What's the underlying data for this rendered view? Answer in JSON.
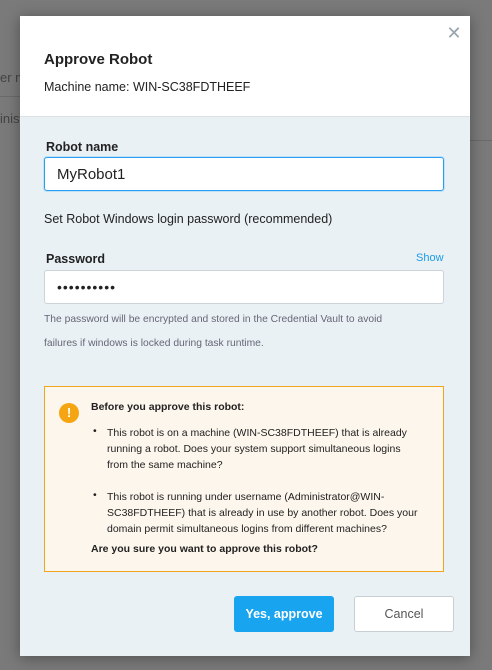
{
  "background": {
    "fragment_1": "er m",
    "fragment_2": "inistr"
  },
  "dialog": {
    "title": "Approve Robot",
    "machine_label": "Machine name:",
    "machine_name": "WIN-SC38FDTHEEF",
    "close_icon": "close-icon",
    "robot_name_label": "Robot name",
    "robot_name_value": "MyRobot1",
    "password_section_text": "Set Robot Windows login password (recommended)",
    "password_label": "Password",
    "password_value": "••••••••••",
    "show_link": "Show",
    "password_hint_line1": "The password will be encrypted and stored in the Credential Vault to avoid",
    "password_hint_line2": "failures if windows is locked during task runtime.",
    "warning": {
      "icon": "warning-icon",
      "heading": "Before you approve this robot:",
      "items": [
        {
          "bullet": "•",
          "lines": [
            "This robot is on a machine (WIN-SC38FDTHEEF) that is already",
            "running a robot. Does your system support simultaneous logins",
            "from the same machine?"
          ]
        },
        {
          "bullet": "•",
          "lines": [
            "This robot is running under username (Administrator@WIN-",
            "SC38FDTHEEF) that is already in use by another robot. Does your",
            "domain permit simultaneous logins from different machines?"
          ]
        }
      ],
      "question": "Are you sure you want to approve this robot?",
      "border_color": "#f0a61c",
      "background_color": "#fdf6ec"
    },
    "approve_button": "Yes, approve",
    "cancel_button": "Cancel",
    "accent_color": "#19a4ef"
  }
}
